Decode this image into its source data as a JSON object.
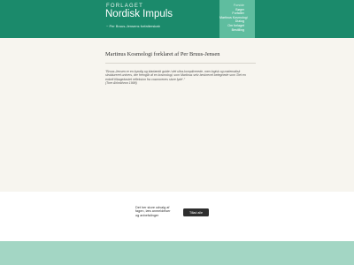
{
  "header": {
    "kicker": "FORLAGET",
    "title": "Nordisk Impuls",
    "subtitle": "~ Per Bruus-Jensens forfatterskab",
    "colors": {
      "primary": "#1b8a6b",
      "nav_bg": "#5fbd9f",
      "footer": "#a3d6c4"
    }
  },
  "nav": {
    "items": [
      {
        "label": "Forside",
        "active": true
      },
      {
        "label": "Bøger",
        "active": false
      },
      {
        "label": "Forfatter",
        "active": false
      },
      {
        "label": "Martinus Kosmologi",
        "active": false
      },
      {
        "label": "Dialog",
        "active": false
      },
      {
        "label": "Om forlaget",
        "active": false
      },
      {
        "label": "Bestilling",
        "active": false
      }
    ]
  },
  "main": {
    "title": "Martinus Kosmologi forklaret af Per Bruus-Jensen",
    "quote": "\"Bruus-Jensen er en kyndig og klartænkt guide i det ultra-komplicerede, men logisk og matematisk struktureret univers, der fremgår af en kosmologi, som Martinus selv beskrevet betegnede som 'Det en enkelt tilbagekastet refleksion fra cosmorenes store lyde'.\"",
    "quote_source": "(Tore Ahlmbhron 1998)"
  },
  "cookie": {
    "text": "Det her store udvalg af fagen, læs anmeldelser og anbefalinger",
    "button_label": "Tillad alle"
  }
}
